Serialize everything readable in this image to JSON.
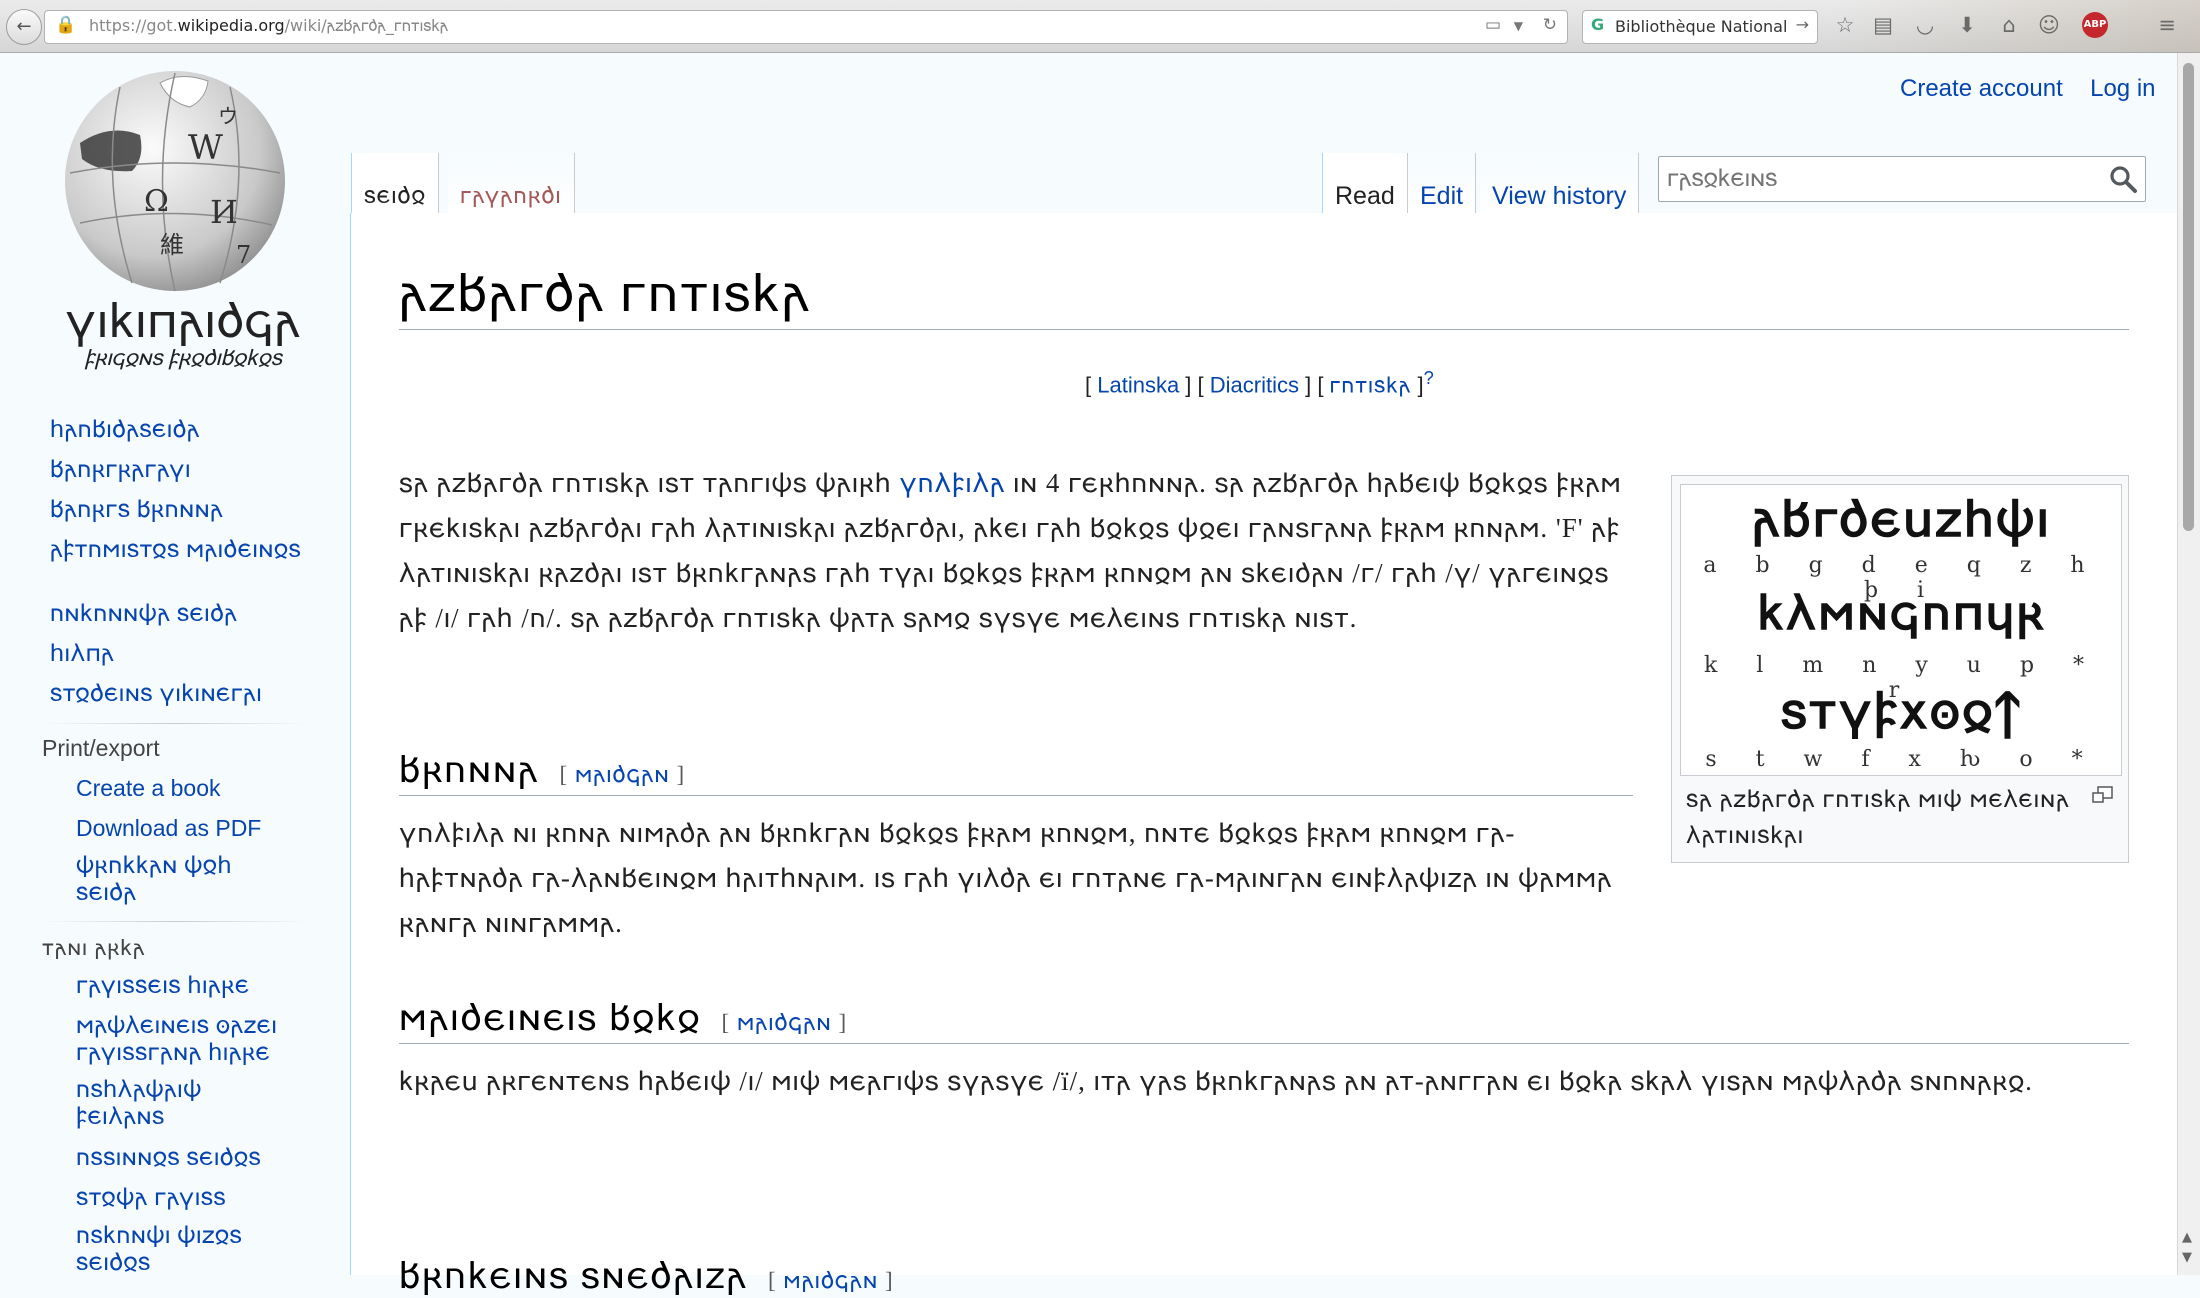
{
  "browser": {
    "url_prefix": "https://got.",
    "url_domain": "wikipedia.org",
    "url_path": "/wiki/𐌰𐌶𐌱𐌰𐌲𐌳𐌰_𐌲𐌿𐍄𐌹𐍃𐌺𐌰",
    "search_engine": "Bibliothèque National"
  },
  "logo": {
    "wordmark": "𐍅𐌹𐌺𐌹𐍀𐌰𐌹𐌳𐌾𐌰",
    "tagline": "𐍆𐍂𐌹𐌾𐍉𐌽𐍃 𐍆𐍂𐍉𐌳𐌹𐌱𐍉𐌺𐍉𐍃"
  },
  "sidebar": {
    "nav": [
      "𐌷𐌰𐌿𐌱𐌹𐌳𐌰𐍃𐌴𐌹𐌳𐌰",
      "𐌱𐌰𐌿𐍂𐌲𐍂𐌰𐌲𐌰𐍅𐌹",
      "𐌱𐌰𐌿𐍂𐌲𐍃 𐌱𐍂𐌿𐌽𐌽𐌰",
      "𐌰𐍆𐍄𐌿𐌼𐌹𐍃𐍄𐍉𐍃 𐌼𐌰𐌹𐌳𐌴𐌹𐌽𐍉𐍃",
      "𐌿𐌽𐌺𐌿𐌽𐌽𐌸𐌰 𐍃𐌴𐌹𐌳𐌰",
      "𐌷𐌹𐌻𐍀𐌰",
      "𐍃𐍄𐍉𐌳𐌴𐌹𐌽𐍃 𐍅𐌹𐌺𐌹𐌽𐌴𐌲𐌰𐌹"
    ],
    "print_heading": "Print/export",
    "print_links": [
      "Create a book",
      "Download as PDF"
    ],
    "print_goth_link": "𐌸𐍂𐌿𐌺𐌺𐌰𐌽 𐌸𐍉𐌷 𐍃𐌴𐌹𐌳𐌰",
    "tools_heading": "𐍄𐌰𐌽𐌹 𐌰𐍂𐌺𐌰",
    "tools": [
      "𐌲𐌰𐍅𐌹𐍃𐍃𐌴𐌹𐍃 𐌷𐌹𐌰𐍂𐌴",
      "𐌼𐌰𐌸𐌻𐌴𐌹𐌽𐌴𐌹𐍃 𐍈𐌰𐌶𐌴𐌹 𐌲𐌰𐍅𐌹𐍃𐍃𐌲𐌰𐌽𐌰 𐌷𐌹𐌰𐍂𐌴",
      "𐌿𐍃𐌷𐌻𐌰𐌸𐌰𐌹𐌸 𐍆𐌴𐌹𐌻𐌰𐌽𐍃",
      "𐌿𐍃𐍃𐌹𐌽𐌽𐍉𐍃 𐍃𐌴𐌹𐌳𐍉𐍃",
      "𐍃𐍄𐍉𐌸𐌰 𐌲𐌰𐍅𐌹𐍃𐍃",
      "𐌿𐍃𐌺𐌿𐌽𐌸𐌹 𐌸𐌹𐌶𐍉𐍃 𐍃𐌴𐌹𐌳𐍉𐍃"
    ]
  },
  "tabs": {
    "left": [
      "𐍃𐌴𐌹𐌳𐍉",
      "𐌲𐌰𐍅𐌰𐌿𐍂𐌳𐌹"
    ],
    "right": [
      "Read",
      "Edit",
      "View history"
    ]
  },
  "user": {
    "create_account": "Create account",
    "log_in": "Log in"
  },
  "search": {
    "placeholder": "𐌲𐌰𐍃𐍉𐌺𐌴𐌹𐌽𐍃"
  },
  "article": {
    "title": "𐌰𐌶𐌱𐌰𐌲𐌳𐌰 𐌲𐌿𐍄𐌹𐍃𐌺𐌰",
    "script_links": {
      "open": "[ ",
      "latinska": "Latinska",
      "sep1": " ] [ ",
      "diacritics": "Diacritics",
      "sep2": " ] [ ",
      "gutiska": "𐌲𐌿𐍄𐌹𐍃𐌺𐌰",
      "close": " ]",
      "q": "?"
    },
    "intro_before_link": "𐍃𐌰 𐌰𐌶𐌱𐌰𐌲𐌳𐌰 𐌲𐌿𐍄𐌹𐍃𐌺𐌰 𐌹𐍃𐍄 𐍄𐌰𐌿𐌲𐌹𐌸𐍃 𐌸𐌰𐌹𐍂𐌷",
    "intro_link": "𐍅𐌿𐌻𐍆𐌹𐌻𐌰",
    "intro_after_link": "𐌹𐌽 4 𐌲𐌴𐍂𐌷𐌿𐌽𐌽𐌰. 𐍃𐌰 𐌰𐌶𐌱𐌰𐌲𐌳𐌰 𐌷𐌰𐌱𐌴𐌹𐌸 𐌱𐍉𐌺𐍉𐍃 𐍆𐍂𐌰𐌼 𐌲𐍂𐌴𐌺𐌹𐍃𐌺𐌰𐌹 𐌰𐌶𐌱𐌰𐌲𐌳𐌰𐌹 𐌲𐌰𐌷 𐌻𐌰𐍄𐌹𐌽𐌹𐍃𐌺𐌰𐌹 𐌰𐌶𐌱𐌰𐌲𐌳𐌰𐌹, 𐌰𐌺𐌴𐌹 𐌲𐌰𐌷 𐌱𐍉𐌺𐍉𐍃 𐌸𐍉𐌴𐌹 𐌲𐌰𐌽𐍃𐌲𐌰𐌽𐌰 𐍆𐍂𐌰𐌼 𐍂𐌿𐌽𐌰𐌼. 'F' 𐌰𐍆 𐌻𐌰𐍄𐌹𐌽𐌹𐍃𐌺𐌰𐌹 𐍂𐌰𐌶𐌳𐌰𐌹 𐌹𐍃𐍄 𐌱𐍂𐌿𐌺𐌲𐌰𐌽𐌰𐍃 𐌲𐌰𐌷 𐍄𐍅𐌰𐌹 𐌱𐍉𐌺𐍉𐍃 𐍆𐍂𐌰𐌼 𐍂𐌿𐌽𐍉𐌼 𐌰𐌽 𐍃𐌺𐌴𐌹𐌳𐌰𐌽 /𐌲/ 𐌲𐌰𐌷 /𐍅/ 𐍅𐌰𐌲𐌴𐌹𐌽𐍉𐍃 𐌰𐍆 /𐌹/ 𐌲𐌰𐌷 /𐌿/. 𐍃𐌰 𐌰𐌶𐌱𐌰𐌲𐌳𐌰 𐌲𐌿𐍄𐌹𐍃𐌺𐌰 𐌸𐌰𐍄𐌰 𐍃𐌰𐌼𐍉 𐍃𐍅𐍃𐍅𐌴 𐌼𐌴𐌻𐌴𐌹𐌽𐍃 𐌲𐌿𐍄𐌹𐍃𐌺𐌰 𐌽𐌹𐍃𐍄.",
    "sections": [
      {
        "title": "𐌱𐍂𐌿𐌽𐌽𐌰",
        "edit": "𐌼𐌰𐌹𐌳𐌾𐌰𐌽",
        "text": "𐍅𐌿𐌻𐍆𐌹𐌻𐌰 𐌽𐌹 𐍂𐌿𐌽𐌰 𐌽𐌹𐌼𐌰𐌳𐌰 𐌰𐌽 𐌱𐍂𐌿𐌺𐌲𐌰𐌽 𐌱𐍉𐌺𐍉𐍃 𐍆𐍂𐌰𐌼 𐍂𐌿𐌽𐍉𐌼, 𐌿𐌽𐍄𐌴 𐌱𐍉𐌺𐍉𐍃 𐍆𐍂𐌰𐌼 𐍂𐌿𐌽𐍉𐌼 𐌲𐌰-𐌷𐌰𐍆𐍄𐌽𐌰𐌳𐌰 𐌲𐌰-𐌻𐌰𐌽𐌱𐌴𐌹𐌽𐍉𐌼 𐌷𐌰𐌹𐍄𐌷𐌽𐌰𐌹𐌼. 𐌹𐍃 𐌲𐌰𐌷 𐍅𐌹𐌻𐌳𐌰 𐌴𐌹 𐌲𐌿𐍄𐌰𐌽𐌴 𐌲𐌰-𐌼𐌰𐌹𐌽𐌲𐌰𐌽 𐌴𐌹𐌽𐍆𐌻𐌰𐌸𐌹𐌶𐌰 𐌹𐌽 𐌸𐌰𐌼𐌼𐌰 𐍂𐌰𐌽𐌲𐌰 𐌽𐌹𐌽𐌲𐌰𐌼𐌼𐌰."
      },
      {
        "title": "𐌼𐌰𐌹𐌳𐌴𐌹𐌽𐌴𐌹𐍃 𐌱𐍉𐌺𐍉",
        "edit": "𐌼𐌰𐌹𐌳𐌾𐌰𐌽",
        "text": "𐌺𐍂𐌰𐌴𐌵 𐌰𐍂𐌲𐌴𐌽𐍄𐌴𐌽𐍃 𐌷𐌰𐌱𐌴𐌹𐌸 /𐌹/ 𐌼𐌹𐌸 𐌼𐌴𐌰𐌲𐌹𐌸𐍃 𐍃𐍅𐌰𐍃𐍅𐌴 /ï/, 𐌹𐍄𐌰 𐍅𐌰𐍃 𐌱𐍂𐌿𐌺𐌲𐌰𐌽𐌰𐍃 𐌰𐌽 𐌰𐍄-𐌰𐌽𐌲𐌲𐌰𐌽 𐌴𐌹 𐌱𐍉𐌺𐌰 𐍃𐌺𐌰𐌻 𐍅𐌹𐍃𐌰𐌽 𐌼𐌰𐌸𐌻𐌰𐌳𐌰 𐍃𐌽𐌿𐌽𐌰𐍂𐍉."
      },
      {
        "title": "𐌱𐍂𐌿𐌺𐌴𐌹𐌽𐍃 𐍃𐌽𐌴𐌳𐌰𐌹𐌶𐌰",
        "edit": "𐌼𐌰𐌹𐌳𐌾𐌰𐌽",
        "text": ""
      }
    ],
    "thumb": {
      "gothic_row1": "𐌰𐌱𐌲𐌳𐌴𐌵𐌶𐌷𐌸𐌹",
      "latin_row1": "a b g d e q z h þ i",
      "gothic_row2": "𐌺𐌻𐌼𐌽𐌾𐌿𐍀𐍁𐍂",
      "latin_row2": "k l m n y u p * r",
      "gothic_row3": "𐍃𐍄𐍅𐍆𐍇𐍈𐍉𐍊",
      "latin_row3": "s t w f x ƕ o *",
      "caption": "𐍃𐌰 𐌰𐌶𐌱𐌰𐌲𐌳𐌰 𐌲𐌿𐍄𐌹𐍃𐌺𐌰 𐌼𐌹𐌸 𐌼𐌴𐌻𐌴𐌹𐌽𐌰 𐌻𐌰𐍄𐌹𐌽𐌹𐍃𐌺𐌰𐌹"
    }
  }
}
